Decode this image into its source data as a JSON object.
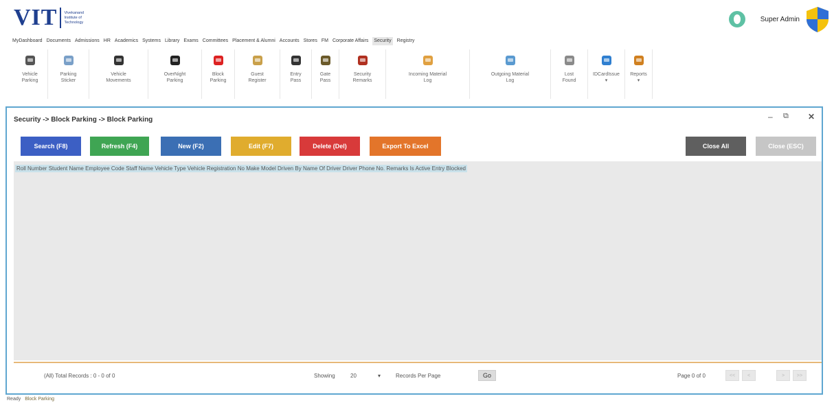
{
  "logo": {
    "text": "VIT",
    "subtitle": "Vivekanand Institute of Technology"
  },
  "user": {
    "name": "Super Admin"
  },
  "menu": [
    "MyDashboard",
    "Documents",
    "Admissions",
    "HR",
    "Academics",
    "Systems",
    "Library",
    "Exams",
    "Committees",
    "Placement & Alumni",
    "Accounts",
    "Stores",
    "FM",
    "Corporate Affairs",
    "Security",
    "Registry"
  ],
  "menu_active": "Security",
  "ribbon": [
    {
      "label": "Vehicle\nParking",
      "icon": "vehicle-parking-icon"
    },
    {
      "label": "Parking\nSticker",
      "icon": "parking-sticker-icon"
    },
    {
      "label": "Vehicle\nMovements",
      "icon": "vehicle-movements-icon"
    },
    {
      "label": "OverNight\nParking",
      "icon": "overnight-parking-icon"
    },
    {
      "label": "Block\nParking",
      "icon": "block-parking-icon"
    },
    {
      "label": "Guest\nRegister",
      "icon": "guest-register-icon"
    },
    {
      "label": "Entry\nPass",
      "icon": "entry-pass-icon"
    },
    {
      "label": "Gate\nPass",
      "icon": "gate-pass-icon"
    },
    {
      "label": "Security\nRemarks",
      "icon": "security-remarks-icon"
    },
    {
      "label": "Incoming Material\nLog",
      "icon": "incoming-material-icon"
    },
    {
      "label": "Outgoing Material\nLog",
      "icon": "outgoing-material-icon"
    },
    {
      "label": "Lost\nFound",
      "icon": "lost-found-icon"
    },
    {
      "label": "IDCardIssue\n▾",
      "icon": "idcard-issue-icon"
    },
    {
      "label": "Reports\n▾",
      "icon": "reports-icon"
    }
  ],
  "panel": {
    "breadcrumb": "Security -> Block Parking -> Block Parking",
    "buttons": {
      "search": "Search (F8)",
      "refresh": "Refresh (F4)",
      "new": "New (F2)",
      "edit": "Edit (F7)",
      "delete": "Delete (Del)",
      "export": "Export To Excel",
      "close_all": "Close All",
      "close": "Close (ESC)"
    },
    "columns": [
      "Roll Number",
      "Student Name",
      "Employee Code",
      "Staff Name",
      "Vehicle Type",
      "Vehicle Registration No",
      "Make",
      "Model",
      "Driven By",
      "Name Of Driver",
      "Driver Phone No.",
      "Remarks",
      "Is Active",
      "Entry Blocked"
    ],
    "footer": {
      "total": "(All) Total Records : 0 - 0 of 0",
      "showing": "Showing",
      "per_page": "20",
      "rpp_label": "Records Per Page",
      "go": "Go",
      "page_info": "Page 0 of 0"
    }
  },
  "status": {
    "ready": "Ready",
    "tab": "Block Parking"
  },
  "colors": {
    "search": "#3c5fc4",
    "refresh": "#3fa553",
    "new": "#3b6fb4",
    "edit": "#e0ac2e",
    "delete": "#d83a3a",
    "export": "#e3752a",
    "close_all": "#5f5f5f",
    "close": "#c6c6c6"
  }
}
